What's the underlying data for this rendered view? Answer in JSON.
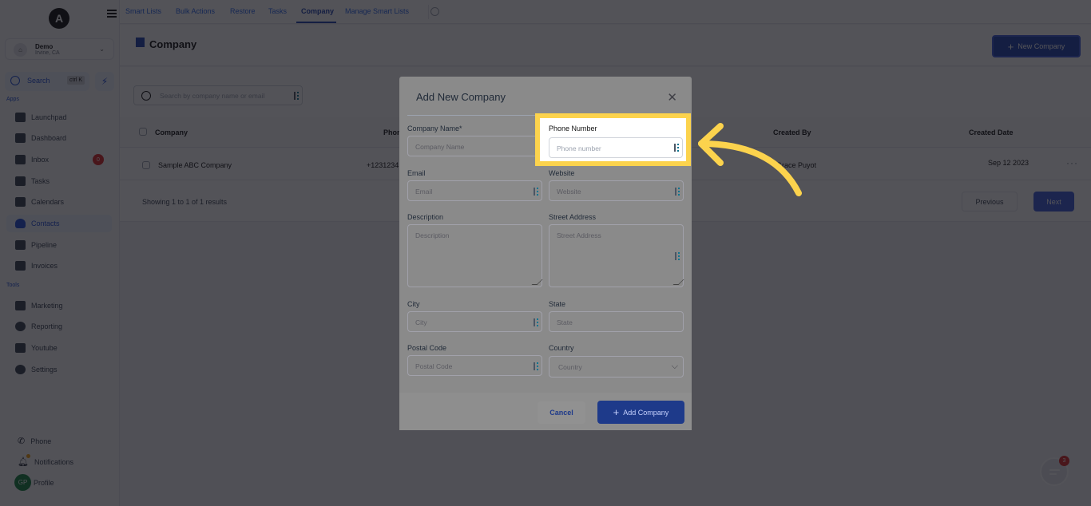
{
  "sidebar": {
    "logo": "A",
    "location": {
      "name": "Demo",
      "sub": "Irvine, CA"
    },
    "search": {
      "label": "Search",
      "shortcut": "ctrl K"
    },
    "apps_label": "Apps",
    "apps": [
      {
        "label": "Launchpad",
        "icon": "rocket-icon"
      },
      {
        "label": "Dashboard",
        "icon": "dashboard-icon"
      },
      {
        "label": "Inbox",
        "icon": "inbox-icon",
        "badge": "0"
      },
      {
        "label": "Tasks",
        "icon": "tasks-icon"
      },
      {
        "label": "Calendars",
        "icon": "calendar-icon"
      },
      {
        "label": "Contacts",
        "icon": "contacts-icon",
        "active": true
      },
      {
        "label": "Pipeline",
        "icon": "pipeline-icon"
      },
      {
        "label": "Invoices",
        "icon": "invoice-icon"
      }
    ],
    "tools_label": "Tools",
    "tools": [
      {
        "label": "Marketing",
        "icon": "megaphone-icon"
      },
      {
        "label": "Reporting",
        "icon": "pie-chart-icon"
      },
      {
        "label": "Youtube",
        "icon": "youtube-icon"
      },
      {
        "label": "Settings",
        "icon": "gear-icon"
      }
    ],
    "bottom": {
      "phone": "Phone",
      "notifications": "Notifications",
      "profile": "Profile",
      "profile_initials": "GP"
    }
  },
  "tabs": [
    {
      "label": "Smart Lists"
    },
    {
      "label": "Bulk Actions"
    },
    {
      "label": "Restore"
    },
    {
      "label": "Tasks"
    },
    {
      "label": "Company",
      "active": true
    },
    {
      "label": "Manage Smart Lists"
    }
  ],
  "header": {
    "title": "Company",
    "new_button": "New Company"
  },
  "list": {
    "search_placeholder": "Search by company name or email",
    "columns": [
      "Company",
      "Phone",
      "Created By",
      "Created Date"
    ],
    "rows": [
      {
        "company": "Sample ABC Company",
        "phone": "+1231234",
        "created_by": "Grace Puyot",
        "created_date": "Sep 12 2023"
      }
    ],
    "results_text": "Showing 1 to 1 of 1 results",
    "prev_label": "Previous",
    "next_label": "Next"
  },
  "chat_widget": {
    "badge": "3"
  },
  "modal": {
    "title": "Add New Company",
    "fields": {
      "company_name": {
        "label": "Company Name*",
        "placeholder": "Company Name"
      },
      "phone": {
        "label": "Phone Number",
        "placeholder": "Phone number"
      },
      "email": {
        "label": "Email",
        "placeholder": "Email"
      },
      "website": {
        "label": "Website",
        "placeholder": "Website"
      },
      "description": {
        "label": "Description",
        "placeholder": "Description"
      },
      "street": {
        "label": "Street Address",
        "placeholder": "Street Address"
      },
      "city": {
        "label": "City",
        "placeholder": "City"
      },
      "state": {
        "label": "State",
        "placeholder": "State"
      },
      "postal": {
        "label": "Postal Code",
        "placeholder": "Postal Code"
      },
      "country": {
        "label": "Country",
        "placeholder": "Country"
      }
    },
    "cancel_label": "Cancel",
    "add_label": "Add Company"
  },
  "annotation": {
    "highlight_color": "#fcd34d"
  }
}
